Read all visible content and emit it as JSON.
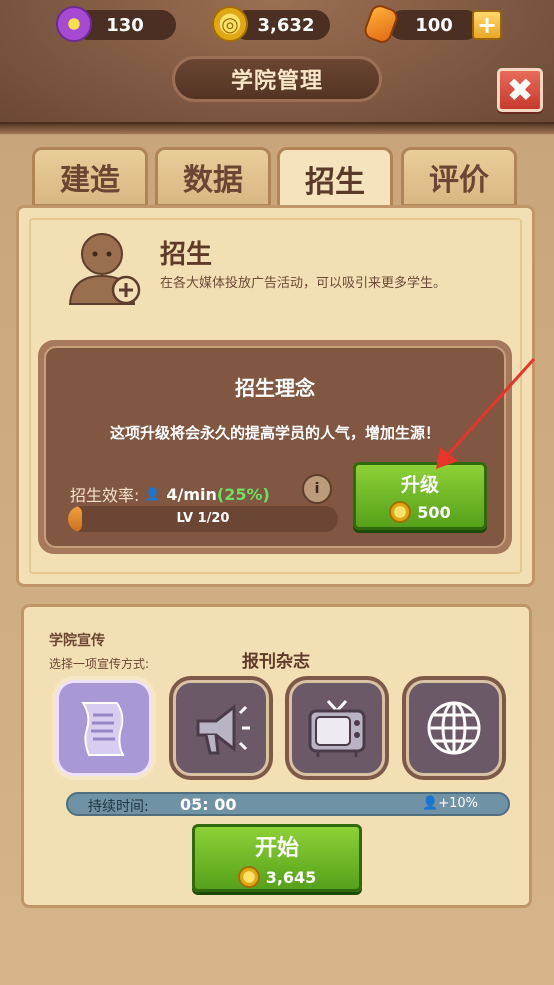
{
  "resources": [
    {
      "icon": "flower-icon",
      "value": "130"
    },
    {
      "icon": "coin-icon",
      "value": "3,632"
    },
    {
      "icon": "gem-icon",
      "value": "100"
    }
  ],
  "header": {
    "title": "学院管理"
  },
  "tabs": [
    {
      "label": "建造",
      "active": false
    },
    {
      "label": "数据",
      "active": false
    },
    {
      "label": "招生",
      "active": true
    },
    {
      "label": "评价",
      "active": false
    }
  ],
  "recruit": {
    "title": "招生",
    "desc": "在各大媒体投放广告活动，可以吸引来更多学生。"
  },
  "concept": {
    "title": "招生理念",
    "desc": "这项升级将会永久的提高学员的人气，增加生源！",
    "rate_label": "招生效率:",
    "rate_value": "4/min",
    "rate_pct": "(25%)",
    "rate_close": ")",
    "level_text": "LV 1/20",
    "level_progress": 0.05,
    "upgrade_label": "升级",
    "upgrade_cost": "500"
  },
  "promo": {
    "title": "学院宣传",
    "subtitle": "选择一项宣传方式:",
    "selected_name": "报刊杂志",
    "options": [
      {
        "icon": "newspaper-icon",
        "selected": true
      },
      {
        "icon": "megaphone-icon",
        "selected": false
      },
      {
        "icon": "tv-icon",
        "selected": false
      },
      {
        "icon": "globe-icon",
        "selected": false
      }
    ],
    "duration_label": "持续时间:",
    "duration_value": "05: 00",
    "bonus": "+10%",
    "start_label": "开始",
    "start_cost": "3,645"
  },
  "colors": {
    "accent_green": "#6bb326",
    "panel": "#f2dfb4",
    "frame": "#815741"
  }
}
